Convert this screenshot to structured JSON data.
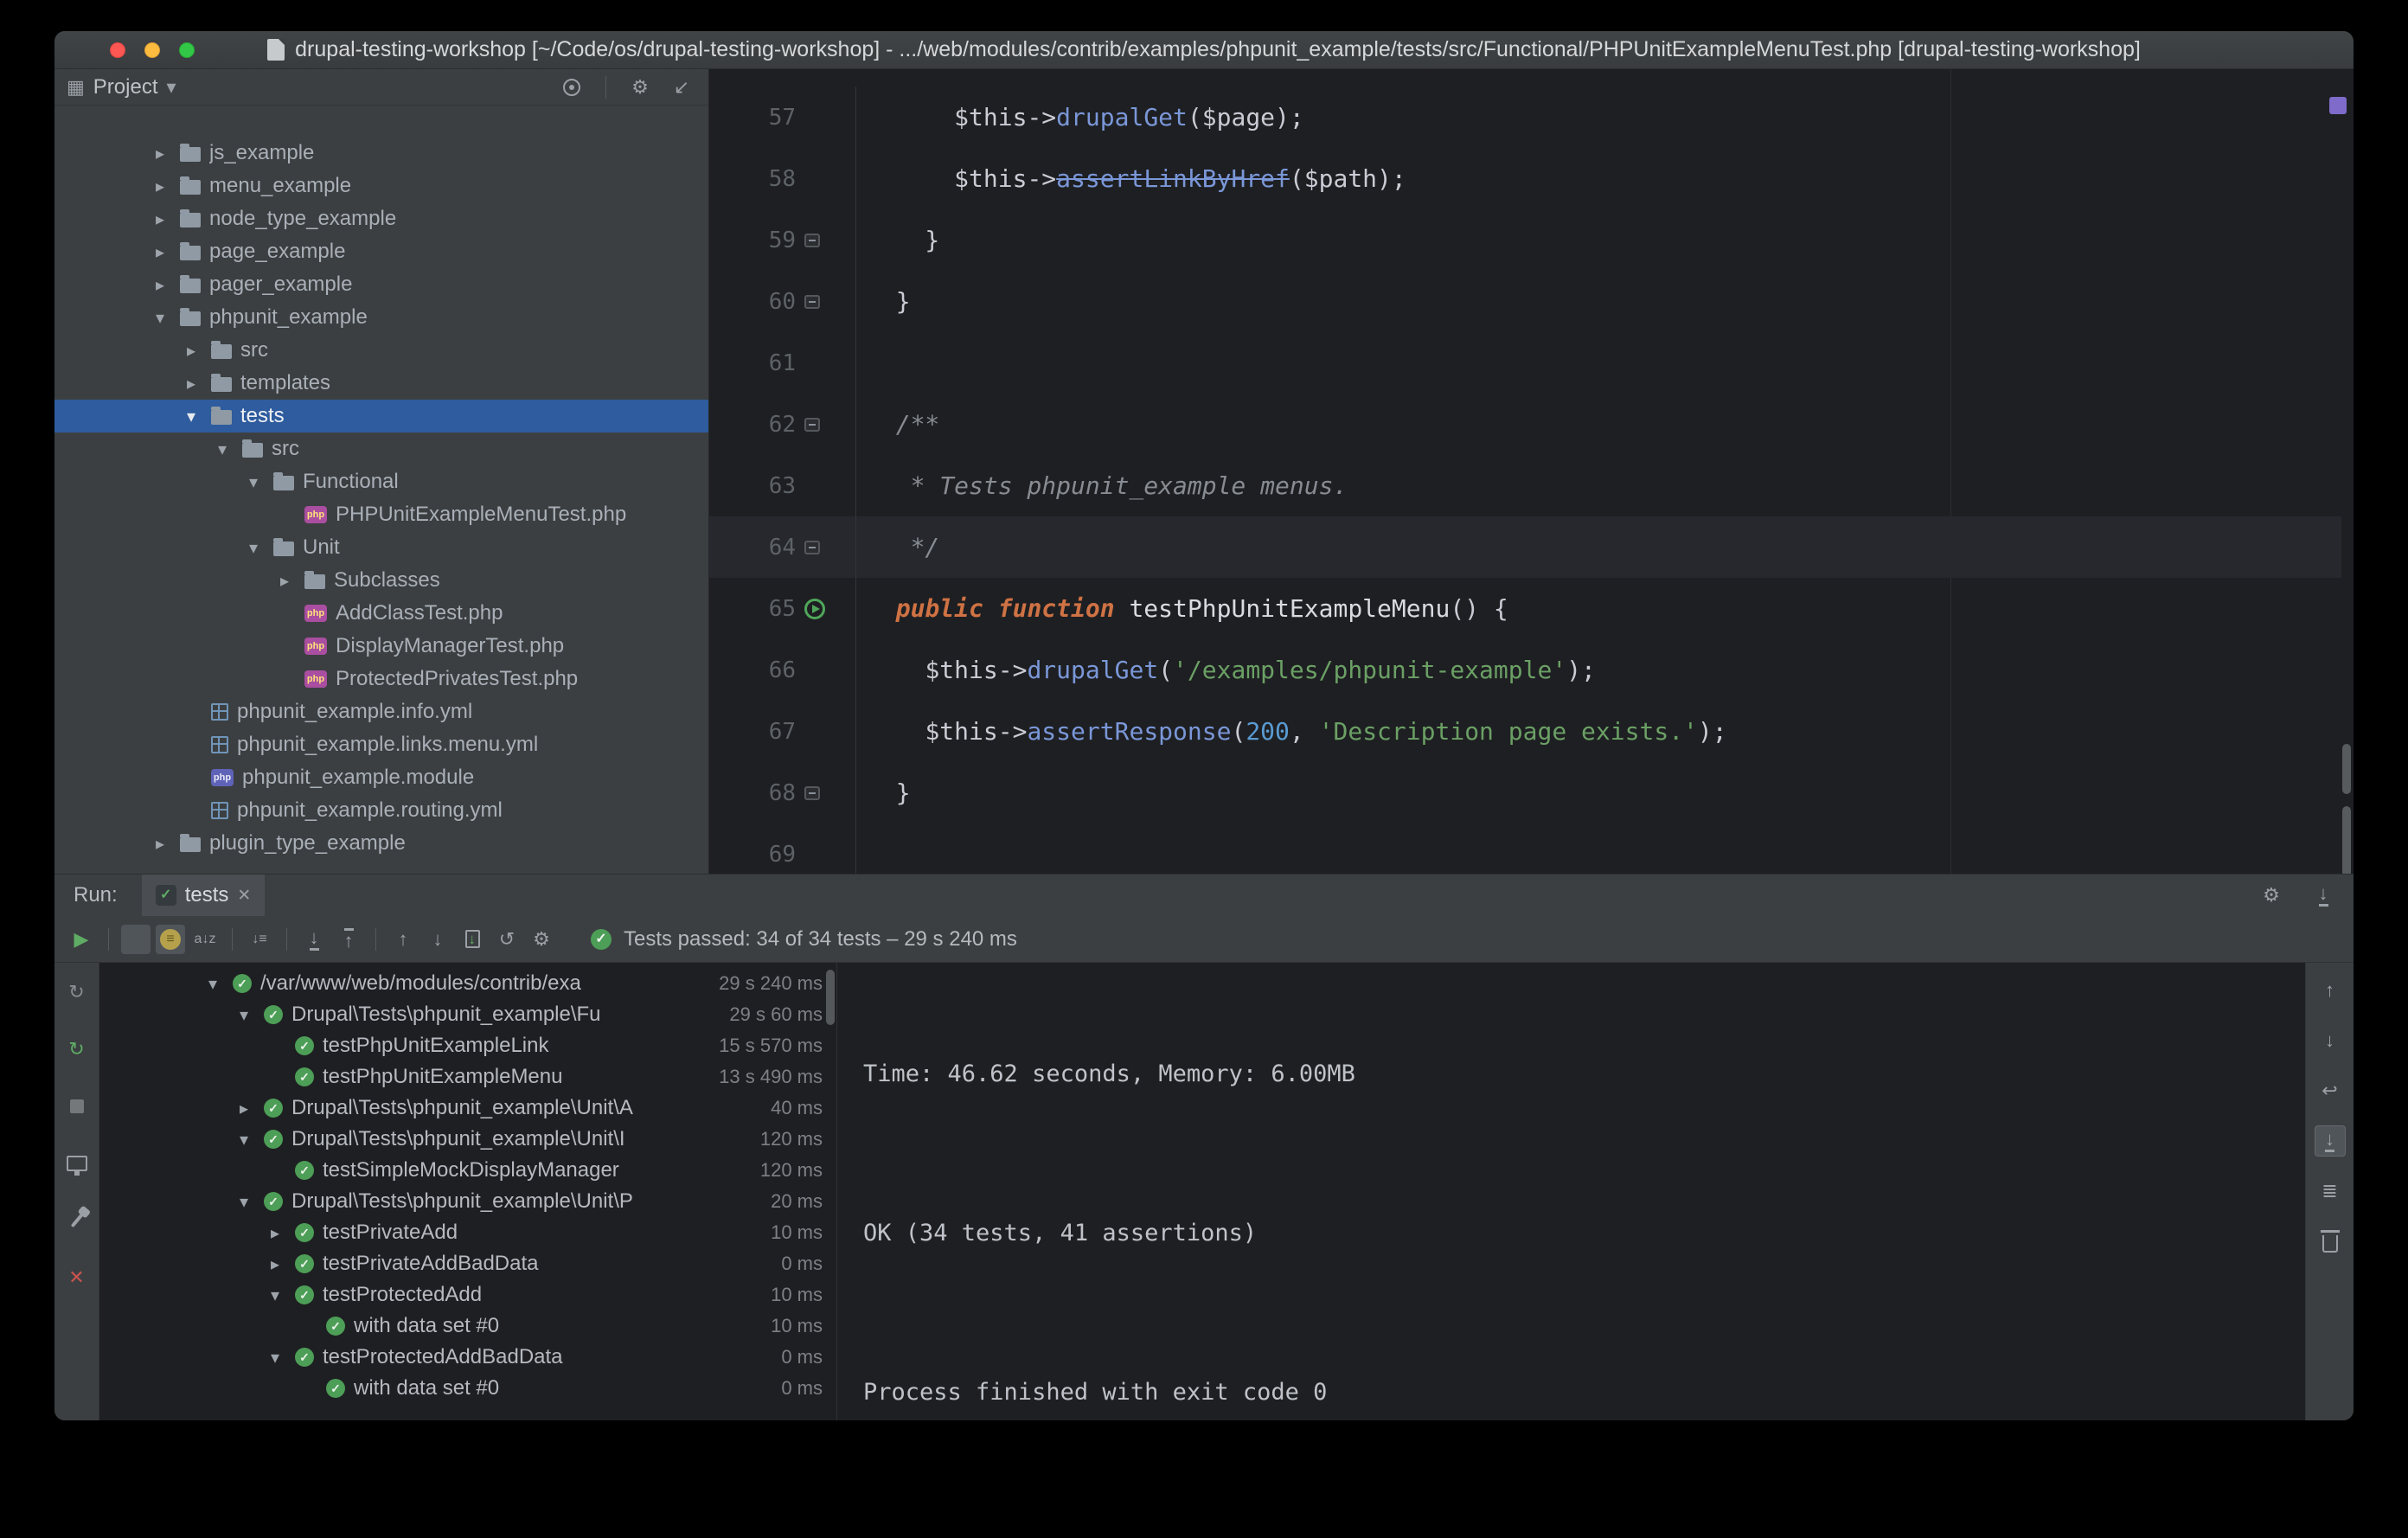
{
  "window": {
    "title": "drupal-testing-workshop [~/Code/os/drupal-testing-workshop] - .../web/modules/contrib/examples/phpunit_example/tests/src/Functional/PHPUnitExampleMenuTest.php [drupal-testing-workshop]"
  },
  "colors": {
    "accent_blue_selection": "#2e5c9e",
    "pass_green": "#4d9e57",
    "editor_background": "#1e1f22",
    "panel_background": "#3c3f41"
  },
  "project": {
    "header": {
      "toolwindow_icon": "▦",
      "title": "Project",
      "caret": "▾",
      "icons": [
        {
          "name": "select-opened-file-icon",
          "type": "target"
        },
        {
          "type": "sep"
        },
        {
          "name": "settings-gear-icon",
          "type": "glyph",
          "glyph": "⚙"
        },
        {
          "name": "hide-panel-icon",
          "type": "glyph",
          "glyph": "↙"
        }
      ]
    },
    "tree": [
      {
        "label": "js_example",
        "level": 0,
        "kind": "folder",
        "arrow": "closed"
      },
      {
        "label": "menu_example",
        "level": 0,
        "kind": "folder",
        "arrow": "closed"
      },
      {
        "label": "node_type_example",
        "level": 0,
        "kind": "folder",
        "arrow": "closed"
      },
      {
        "label": "page_example",
        "level": 0,
        "kind": "folder",
        "arrow": "closed"
      },
      {
        "label": "pager_example",
        "level": 0,
        "kind": "folder",
        "arrow": "closed"
      },
      {
        "label": "phpunit_example",
        "level": 0,
        "kind": "folder",
        "arrow": "open"
      },
      {
        "label": "src",
        "level": 1,
        "kind": "folder",
        "arrow": "closed"
      },
      {
        "label": "templates",
        "level": 1,
        "kind": "folder",
        "arrow": "closed"
      },
      {
        "label": "tests",
        "level": 1,
        "kind": "folder",
        "arrow": "open",
        "selected": true
      },
      {
        "label": "src",
        "level": 2,
        "kind": "folder",
        "arrow": "open"
      },
      {
        "label": "Functional",
        "level": 3,
        "kind": "folder",
        "arrow": "open"
      },
      {
        "label": "PHPUnitExampleMenuTest.php",
        "level": 4,
        "kind": "phptest"
      },
      {
        "label": "Unit",
        "level": 3,
        "kind": "folder",
        "arrow": "open"
      },
      {
        "label": "Subclasses",
        "level": 4,
        "kind": "folder",
        "arrow": "closed"
      },
      {
        "label": "AddClassTest.php",
        "level": 4,
        "kind": "phptest"
      },
      {
        "label": "DisplayManagerTest.php",
        "level": 4,
        "kind": "phptest"
      },
      {
        "label": "ProtectedPrivatesTest.php",
        "level": 4,
        "kind": "phptest"
      },
      {
        "label": "phpunit_example.info.yml",
        "level": 1,
        "kind": "yml"
      },
      {
        "label": "phpunit_example.links.menu.yml",
        "level": 1,
        "kind": "yml"
      },
      {
        "label": "phpunit_example.module",
        "level": 1,
        "kind": "phpfile"
      },
      {
        "label": "phpunit_example.routing.yml",
        "level": 1,
        "kind": "yml"
      },
      {
        "label": "plugin_type_example",
        "level": 0,
        "kind": "folder",
        "arrow": "closed"
      }
    ]
  },
  "editor": {
    "lines": [
      {
        "num": "57",
        "tokens": [
          [
            "pl",
            "      "
          ],
          [
            "var",
            "$this"
          ],
          [
            "pl",
            "->"
          ],
          [
            "mth",
            "drupalGet"
          ],
          [
            "pl",
            "("
          ],
          [
            "var",
            "$page"
          ],
          [
            "pl",
            ");"
          ]
        ]
      },
      {
        "num": "58",
        "tokens": [
          [
            "pl",
            "      "
          ],
          [
            "var",
            "$this"
          ],
          [
            "pl",
            "->"
          ],
          [
            "mthdep",
            "assertLinkByHref"
          ],
          [
            "pl",
            "("
          ],
          [
            "var",
            "$path"
          ],
          [
            "pl",
            ");"
          ]
        ]
      },
      {
        "num": "59",
        "marker": "fold",
        "tokens": [
          [
            "pl",
            "    }"
          ]
        ]
      },
      {
        "num": "60",
        "marker": "fold",
        "tokens": [
          [
            "pl",
            "  }"
          ]
        ]
      },
      {
        "num": "61",
        "tokens": []
      },
      {
        "num": "62",
        "marker": "fold",
        "tokens": [
          [
            "cmt",
            "  /**"
          ]
        ]
      },
      {
        "num": "63",
        "tokens": [
          [
            "cmt",
            "   * Tests phpunit_example menus."
          ]
        ]
      },
      {
        "num": "64",
        "marker": "fold",
        "current": true,
        "tokens": [
          [
            "cmt",
            "   */"
          ]
        ]
      },
      {
        "num": "65",
        "marker": "run",
        "tokens": [
          [
            "pl",
            "  "
          ],
          [
            "kw",
            "public"
          ],
          [
            "pl",
            " "
          ],
          [
            "kw",
            "function"
          ],
          [
            "pl",
            " "
          ],
          [
            "fn",
            "testPhpUnitExampleMenu"
          ],
          [
            "pl",
            "() {"
          ]
        ]
      },
      {
        "num": "66",
        "tokens": [
          [
            "pl",
            "    "
          ],
          [
            "var",
            "$this"
          ],
          [
            "pl",
            "->"
          ],
          [
            "mth",
            "drupalGet"
          ],
          [
            "pl",
            "("
          ],
          [
            "str",
            "'/examples/phpunit-example'"
          ],
          [
            "pl",
            ");"
          ]
        ]
      },
      {
        "num": "67",
        "tokens": [
          [
            "pl",
            "    "
          ],
          [
            "var",
            "$this"
          ],
          [
            "pl",
            "->"
          ],
          [
            "mthwarn",
            "assertResponse"
          ],
          [
            "pl",
            "("
          ],
          [
            "num2",
            "200"
          ],
          [
            "pl",
            ", "
          ],
          [
            "str",
            "'Description page exists.'"
          ],
          [
            "pl",
            ");"
          ]
        ]
      },
      {
        "num": "68",
        "marker": "fold",
        "tokens": [
          [
            "pl",
            "  }"
          ]
        ]
      },
      {
        "num": "69",
        "tokens": []
      }
    ]
  },
  "run": {
    "label": "Run:",
    "tab": {
      "label": "tests",
      "close": "✕"
    },
    "tabbar_icons": [
      {
        "name": "settings-gear-icon",
        "type": "glyph",
        "glyph": "⚙"
      },
      {
        "name": "dock-pin-icon",
        "type": "barbottom"
      }
    ],
    "toolbar": [
      {
        "name": "rerun-tests-button",
        "type": "glyph",
        "glyph": "▶",
        "color": "#5fad65"
      },
      {
        "type": "sep"
      },
      {
        "name": "show-passed-toggle",
        "type": "check",
        "active": true
      },
      {
        "name": "show-ignored-toggle",
        "type": "ignored",
        "active": true
      },
      {
        "name": "sort-alphabetically-button",
        "type": "glyph",
        "glyph": "a↓z",
        "small": true
      },
      {
        "type": "sep"
      },
      {
        "name": "sort-by-duration-button",
        "type": "glyph",
        "glyph": "↓≡",
        "small": true
      },
      {
        "type": "sep"
      },
      {
        "name": "expand-all-button",
        "type": "barbottom"
      },
      {
        "name": "collapse-all-button",
        "type": "bartop"
      },
      {
        "type": "sep"
      },
      {
        "name": "previous-occurrence-button",
        "type": "glyph",
        "glyph": "↑"
      },
      {
        "name": "next-occurrence-button",
        "type": "glyph",
        "glyph": "↓"
      },
      {
        "name": "import-test-results-button",
        "type": "import"
      },
      {
        "name": "test-history-button",
        "type": "glyph",
        "glyph": "↺"
      },
      {
        "name": "test-runner-settings-gear-button",
        "type": "glyph",
        "glyph": "⚙"
      }
    ],
    "status": "Tests passed: 34 of 34 tests – 29 s 240 ms",
    "left_strip": [
      {
        "name": "rerun-icon",
        "type": "glyph",
        "glyph": "↻",
        "color": "#8a8e92"
      },
      {
        "name": "rerun-failed-tests-icon",
        "type": "glyph",
        "glyph": "↻",
        "color": "#5fad65"
      },
      {
        "name": "stop-icon",
        "type": "stop"
      },
      {
        "name": "test-results-console-icon",
        "type": "monitor"
      },
      {
        "name": "pin-tab-icon",
        "type": "pin"
      },
      {
        "name": "close-icon",
        "type": "glyph",
        "glyph": "✕",
        "color": "#c75450"
      }
    ],
    "tree": [
      {
        "label": "/var/www/web/modules/contrib/exa",
        "duration": "29 s 240 ms",
        "level": 0,
        "arrow": "open"
      },
      {
        "label": "Drupal\\Tests\\phpunit_example\\Fu",
        "duration": "29 s 60 ms",
        "level": 1,
        "arrow": "open"
      },
      {
        "label": "testPhpUnitExampleLink",
        "duration": "15 s 570 ms",
        "level": 2
      },
      {
        "label": "testPhpUnitExampleMenu",
        "duration": "13 s 490 ms",
        "level": 2
      },
      {
        "label": "Drupal\\Tests\\phpunit_example\\Unit\\A",
        "duration": "40 ms",
        "level": 1,
        "arrow": "closed"
      },
      {
        "label": "Drupal\\Tests\\phpunit_example\\Unit\\I",
        "duration": "120 ms",
        "level": 1,
        "arrow": "open"
      },
      {
        "label": "testSimpleMockDisplayManager",
        "duration": "120 ms",
        "level": 2
      },
      {
        "label": "Drupal\\Tests\\phpunit_example\\Unit\\P",
        "duration": "20 ms",
        "level": 1,
        "arrow": "open"
      },
      {
        "label": "testPrivateAdd",
        "duration": "10 ms",
        "level": 2,
        "arrow": "closed"
      },
      {
        "label": "testPrivateAddBadData",
        "duration": "0 ms",
        "level": 2,
        "arrow": "closed"
      },
      {
        "label": "testProtectedAdd",
        "duration": "10 ms",
        "level": 2,
        "arrow": "open"
      },
      {
        "label": "with data set #0",
        "duration": "10 ms",
        "level": 3
      },
      {
        "label": "testProtectedAddBadData",
        "duration": "0 ms",
        "level": 2,
        "arrow": "open"
      },
      {
        "label": "with data set #0",
        "duration": "0 ms",
        "level": 3
      }
    ],
    "console": {
      "lines": [
        "",
        "",
        "Time: 46.62 seconds, Memory: 6.00MB",
        "",
        "",
        "",
        "OK (34 tests, 41 assertions)",
        "",
        "",
        "",
        "Process finished with exit code 0"
      ]
    },
    "right_strip": [
      {
        "name": "up-stacktrace-icon",
        "type": "glyph",
        "glyph": "↑"
      },
      {
        "name": "down-stacktrace-icon",
        "type": "glyph",
        "glyph": "↓"
      },
      {
        "name": "soft-wrap-icon",
        "type": "glyph",
        "glyph": "↩"
      },
      {
        "name": "scroll-to-end-icon",
        "type": "barbottom",
        "active": true
      },
      {
        "name": "print-icon",
        "type": "glyph",
        "glyph": "≣"
      },
      {
        "name": "clear-all-icon",
        "type": "trash"
      }
    ]
  }
}
